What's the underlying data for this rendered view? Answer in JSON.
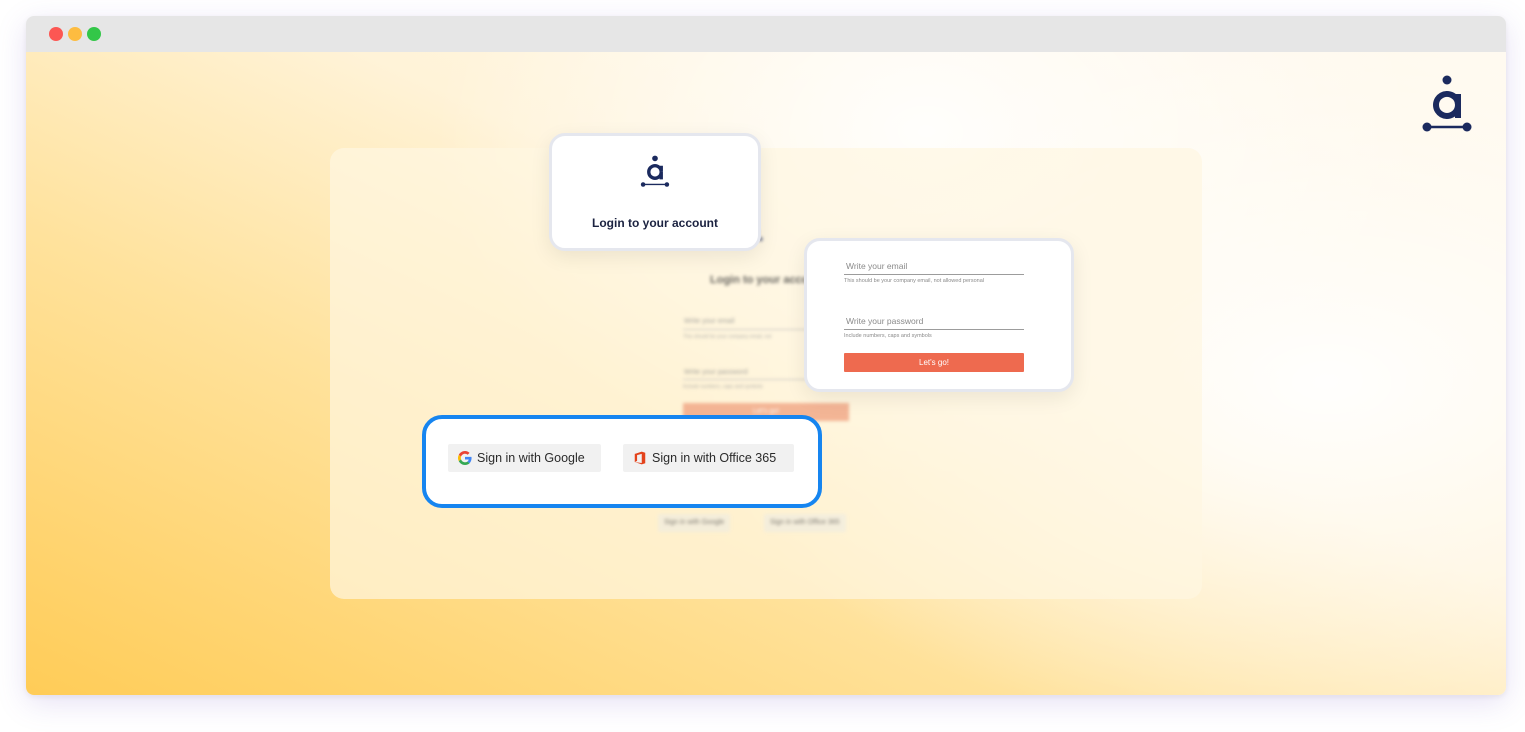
{
  "window": {
    "controls": [
      "close",
      "minimize",
      "zoom"
    ]
  },
  "brand": {
    "logo_icon": "brand-a-logo-icon",
    "color": "#1b2a5e"
  },
  "background_form": {
    "title": "Login to your account",
    "email_placeholder": "Write your email",
    "email_hint": "This should be your company email, not",
    "password_placeholder": "Write your password",
    "password_hint": "Include numbers, caps and symbols",
    "submit_label": "Let's go!",
    "google_label": "Sign in with Google",
    "office_label": "Sign in with Office 365"
  },
  "login_card": {
    "title": "Login to your account"
  },
  "form_card": {
    "email_placeholder": "Write your email",
    "email_hint": "This should be your company email, not allowed personal",
    "password_placeholder": "Write your password",
    "password_hint": "Include numbers, caps and symbols",
    "submit_label": "Let's go!"
  },
  "sso": {
    "google_label": "Sign in with Google",
    "google_icon": "google-icon",
    "office_label": "Sign in with Office 365",
    "office_icon": "office-365-icon",
    "highlight_color": "#1685f0"
  },
  "colors": {
    "accent": "#ee6a4f",
    "background_gradient": [
      "#ffcc57",
      "#fffaf0"
    ]
  }
}
